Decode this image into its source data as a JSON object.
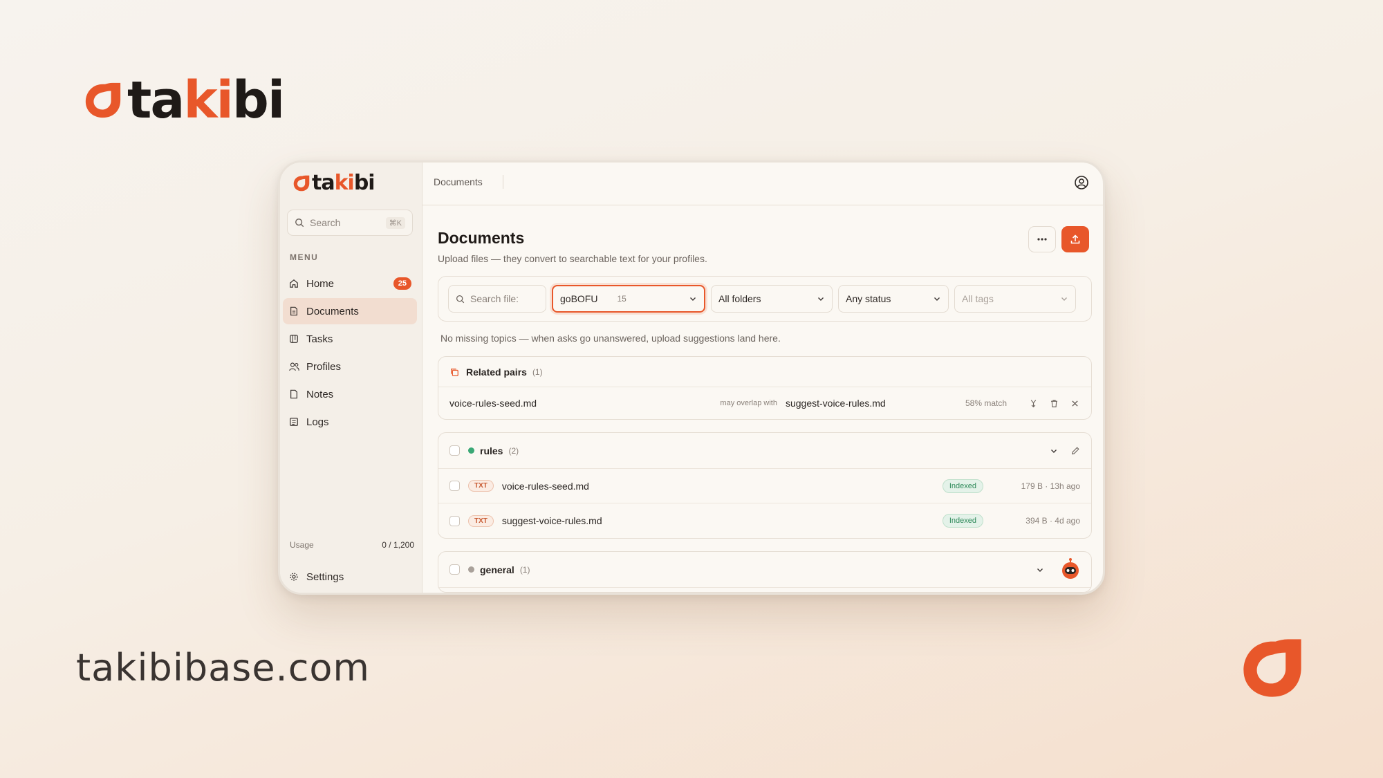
{
  "brand": {
    "name_prefix": "ta",
    "name_accent": "ki",
    "name_suffix": "bi",
    "domain": "takibibase.com",
    "accent_color": "#e8572a"
  },
  "sidebar": {
    "search_placeholder": "Search",
    "search_shortcut": "⌘K",
    "menu_label": "MENU",
    "items": [
      {
        "label": "Home",
        "icon": "home-icon",
        "badge": "25"
      },
      {
        "label": "Documents",
        "icon": "document-icon",
        "active": true
      },
      {
        "label": "Tasks",
        "icon": "tasks-icon"
      },
      {
        "label": "Profiles",
        "icon": "users-icon"
      },
      {
        "label": "Notes",
        "icon": "notes-icon"
      },
      {
        "label": "Logs",
        "icon": "logs-icon"
      }
    ],
    "usage_label": "Usage",
    "usage_value": "0 / 1,200",
    "settings_label": "Settings"
  },
  "topbar": {
    "breadcrumb": "Documents"
  },
  "page": {
    "title": "Documents",
    "subtitle": "Upload files — they convert to searchable text for your profiles."
  },
  "filters": {
    "search_placeholder": "Search file:",
    "profile_value": "goBOFU",
    "profile_count": "15",
    "folders_value": "All folders",
    "status_value": "Any status",
    "tags_value": "All tags"
  },
  "note": "No missing topics — when asks go unanswered, upload suggestions land here.",
  "related_pairs": {
    "title": "Related pairs",
    "count": "(1)",
    "pair": {
      "a": "voice-rules-seed.md",
      "relation": "may overlap with",
      "b": "suggest-voice-rules.md",
      "match": "58% match"
    }
  },
  "groups": [
    {
      "name": "rules",
      "count": "(2)",
      "dot_color": "#3aa876",
      "docs": [
        {
          "type": "TXT",
          "name": "voice-rules-seed.md",
          "status": "Indexed",
          "meta": "179 B · 13h ago"
        },
        {
          "type": "TXT",
          "name": "suggest-voice-rules.md",
          "status": "Indexed",
          "meta": "394 B · 4d ago"
        }
      ]
    },
    {
      "name": "general",
      "count": "(1)",
      "dot_color": "#a9a19a"
    }
  ]
}
